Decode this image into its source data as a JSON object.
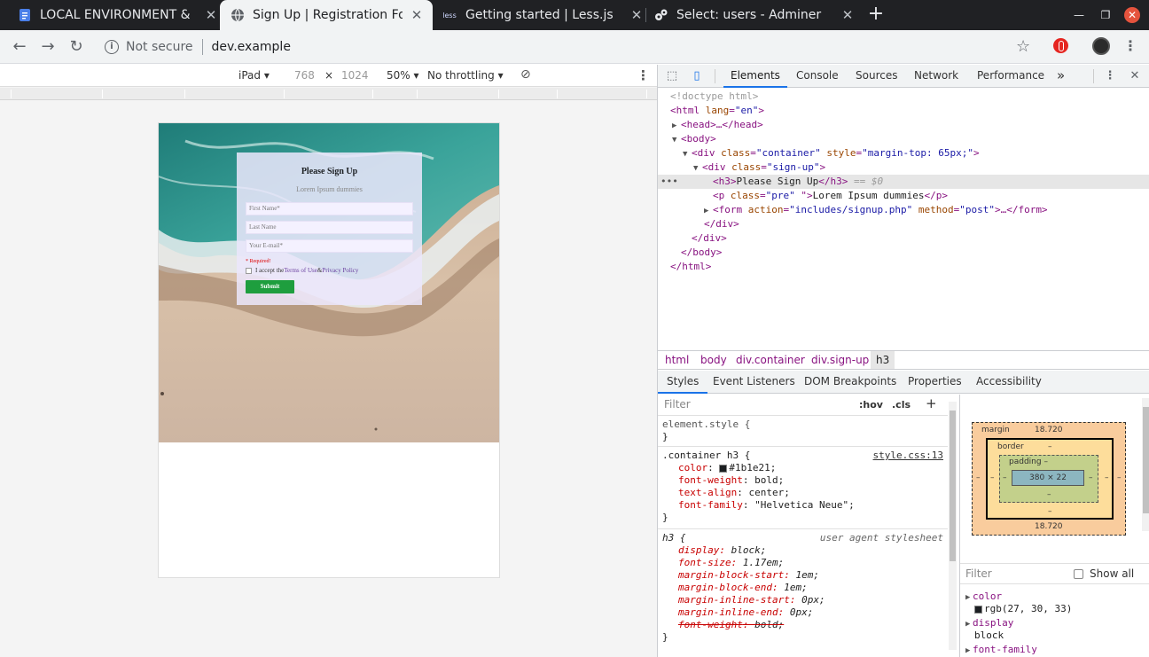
{
  "tabs": [
    {
      "title": "LOCAL ENVIRONMENT &",
      "icon": "document-icon",
      "active": false
    },
    {
      "title": "Sign Up | Registration For",
      "icon": "globe-icon",
      "active": true
    },
    {
      "title": "Getting started | Less.js",
      "icon": "less-logo-icon",
      "favicon_text": "less",
      "active": false
    },
    {
      "title": "Select: users - Adminer",
      "icon": "adminer-icon",
      "active": false
    }
  ],
  "address": {
    "security": "Not secure",
    "url": "dev.example"
  },
  "device_toolbar": {
    "device": "iPad",
    "width": "768",
    "times": "×",
    "height": "1024",
    "zoom": "50%",
    "throttle": "No throttling"
  },
  "page": {
    "heading": "Please Sign Up",
    "subtitle": "Lorem Ipsum dummies",
    "inputs": [
      "First Name*",
      "Last Name",
      "Your E-mail*"
    ],
    "required": "* Required!",
    "accept_prefix": "I accept the ",
    "terms": "Terms of Use",
    "amp": " & ",
    "privacy": "Privacy Policy",
    "submit": "Submit"
  },
  "devtools": {
    "tabs": [
      "Elements",
      "Console",
      "Sources",
      "Network",
      "Performance"
    ],
    "more": "»",
    "dom": {
      "doctype": "<!doctype html>",
      "html_open": "<html",
      "html_lang_attr": "lang",
      "html_lang_val": "\"en\"",
      "head": "<head>…</head>",
      "body_open": "<body>",
      "div_container": "<div",
      "class_attr": "class",
      "container_val": "\"container\"",
      "style_attr": "style",
      "style_val": "\"margin-top: 65px;\"",
      "signup_val": "\"sign-up\"",
      "h3_open": "<h3>",
      "h3_text": "Please Sign Up",
      "h3_close": "</h3>",
      "selected_marker": "== $0",
      "p_open": "<p",
      "p_class_val": "\"pre\"",
      "p_text": "Lorem Ipsum dummies",
      "p_close": "</p>",
      "form_open": "<form",
      "action_attr": "action",
      "action_val": "\"includes/signup.php\"",
      "method_attr": "method",
      "method_val": "\"post\"",
      "form_rest": "…</form>",
      "div_close": "</div>",
      "body_close": "</body>",
      "html_close": "</html>"
    },
    "breadcrumbs": [
      "html",
      "body",
      "div.container",
      "div.sign-up",
      "h3"
    ],
    "subtabs": [
      "Styles",
      "Event Listeners",
      "DOM Breakpoints",
      "Properties",
      "Accessibility"
    ],
    "styles": {
      "filter_placeholder": "Filter",
      "hov": ":hov",
      "cls": ".cls",
      "plus": "+",
      "element_style": "element.style {",
      "close_brace": "}",
      "rule1_selector": ".container h3 {",
      "rule1_source": "style.css:13",
      "rule1_props": [
        {
          "name": "color",
          "value": "#1b1e21;",
          "swatch": "#1b1e21"
        },
        {
          "name": "font-weight",
          "value": "bold;"
        },
        {
          "name": "text-align",
          "value": "center;"
        },
        {
          "name": "font-family",
          "value": "\"Helvetica Neue\";"
        }
      ],
      "rule2_selector": "h3 {",
      "rule2_source": "user agent stylesheet",
      "rule2_props": [
        {
          "name": "display",
          "value": "block;"
        },
        {
          "name": "font-size",
          "value": "1.17em;"
        },
        {
          "name": "margin-block-start",
          "value": "1em;"
        },
        {
          "name": "margin-block-end",
          "value": "1em;"
        },
        {
          "name": "margin-inline-start",
          "value": "0px;"
        },
        {
          "name": "margin-inline-end",
          "value": "0px;"
        },
        {
          "name": "font-weight",
          "value": "bold;"
        }
      ]
    },
    "boxmodel": {
      "margin_label": "margin",
      "margin_top": "18.720",
      "margin_bottom": "18.720",
      "margin_side": "–",
      "border_label": "border",
      "border_val": "–",
      "padding_label": "padding",
      "padding_val": "–",
      "content": "380 × 22"
    },
    "computed": {
      "filter_placeholder": "Filter",
      "show_all": "Show all",
      "props": [
        {
          "name": "color",
          "value": "rgb(27, 30, 33)",
          "swatch": "#1b1e21"
        },
        {
          "name": "display",
          "value": "block"
        },
        {
          "name": "font-family",
          "value": ""
        }
      ]
    }
  },
  "colors": {
    "tabstrip": "#202124",
    "toolbar": "#f1f3f4",
    "accent": "#1a73e8",
    "submit": "#1e9e3e",
    "close_window": "#e5533d"
  }
}
